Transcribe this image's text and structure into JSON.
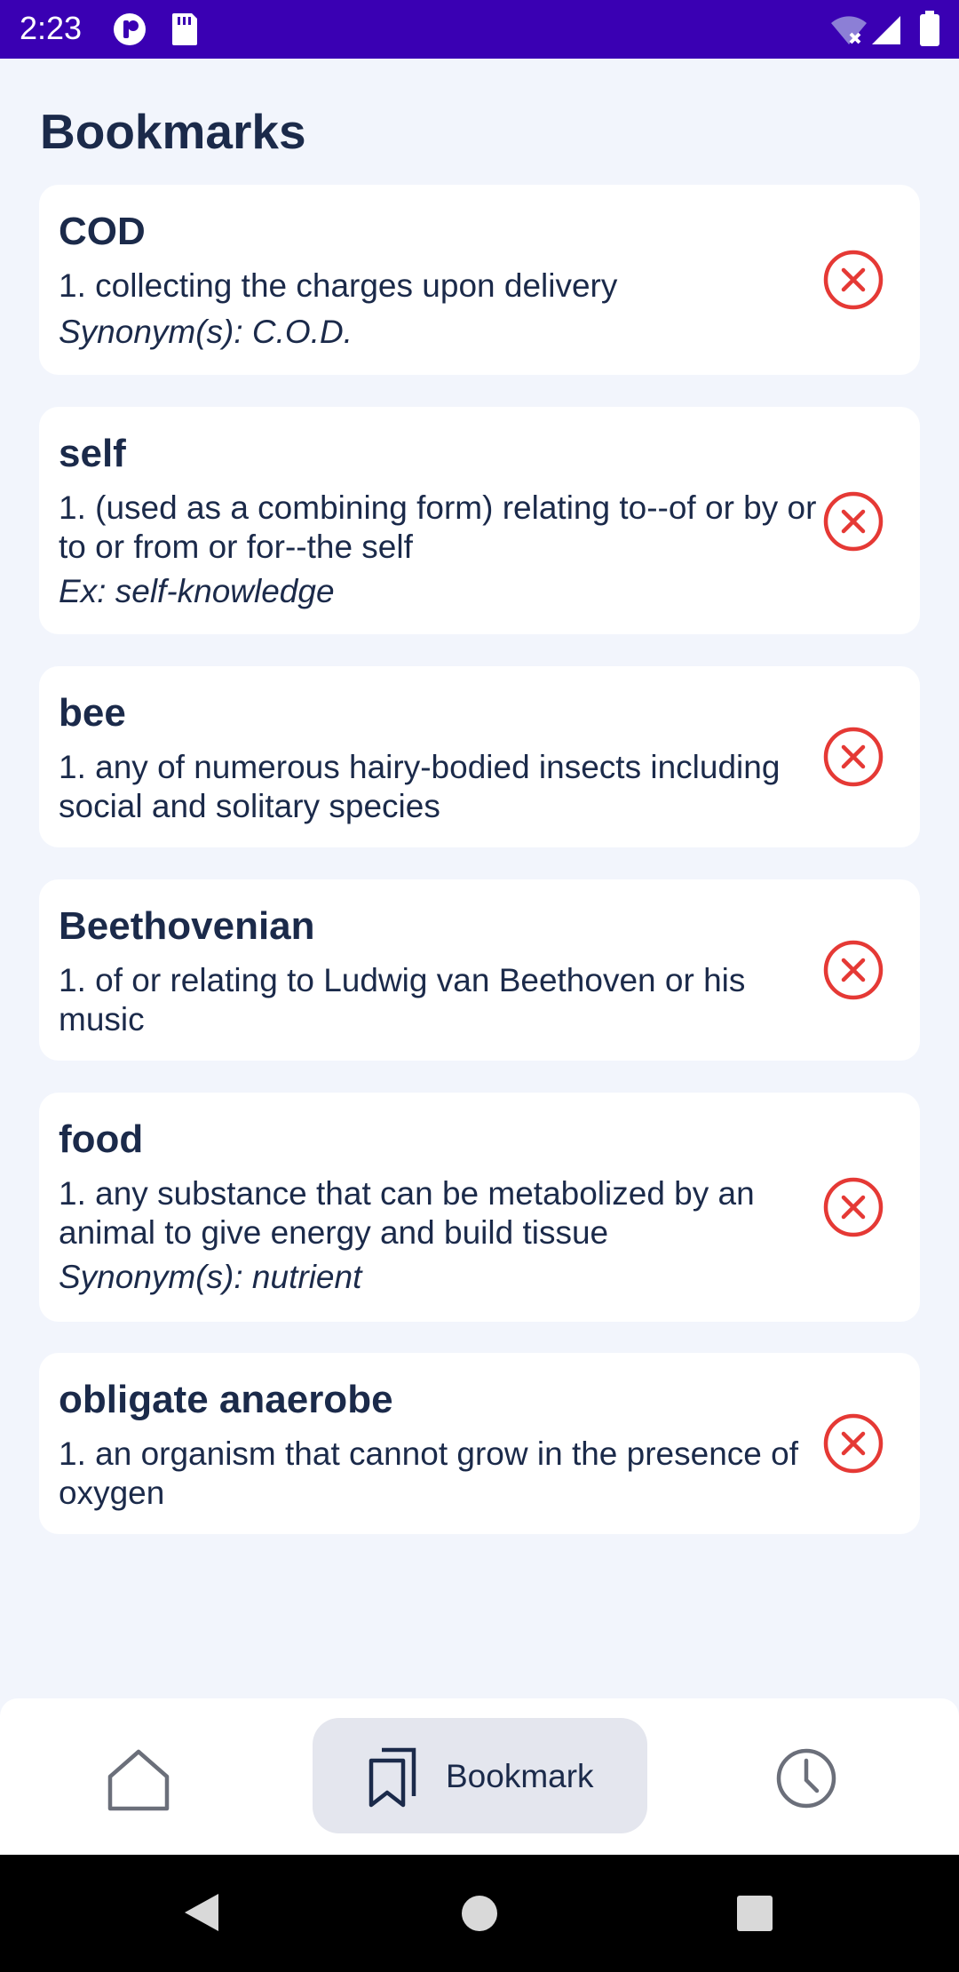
{
  "status_bar": {
    "time": "2:23",
    "icons": [
      "app-notification-icon",
      "sd-card-icon",
      "wifi-icon",
      "signal-icon",
      "battery-icon"
    ]
  },
  "page": {
    "title": "Bookmarks"
  },
  "bookmarks": [
    {
      "word": "COD",
      "definition": "1. collecting the charges upon delivery",
      "extra": "Synonym(s): C.O.D."
    },
    {
      "word": "self",
      "definition": "1. (used as a combining form) relating to--of or by or to or from or for--the self",
      "extra": "Ex: self-knowledge"
    },
    {
      "word": "bee",
      "definition": "1. any of numerous hairy-bodied insects including social and solitary species",
      "extra": ""
    },
    {
      "word": "Beethovenian",
      "definition": "1. of or relating to Ludwig van Beethoven or his music",
      "extra": ""
    },
    {
      "word": "food",
      "definition": "1. any substance that can be metabolized by an animal to give energy and build tissue",
      "extra": "Synonym(s): nutrient"
    },
    {
      "word": "obligate anaerobe",
      "definition": "1. an organism that cannot grow in the presence of oxygen",
      "extra": ""
    }
  ],
  "bottom_nav": {
    "items": [
      {
        "icon": "home-icon",
        "label": ""
      },
      {
        "icon": "bookmark-icon",
        "label": "Bookmark",
        "selected": true
      },
      {
        "icon": "history-icon",
        "label": ""
      }
    ]
  },
  "colors": {
    "status_bar": "#3a00b3",
    "background": "#f2f5fc",
    "card": "#ffffff",
    "text": "#1b2a4a",
    "remove": "#e53935",
    "nav_selected": "#e4e6ee"
  }
}
